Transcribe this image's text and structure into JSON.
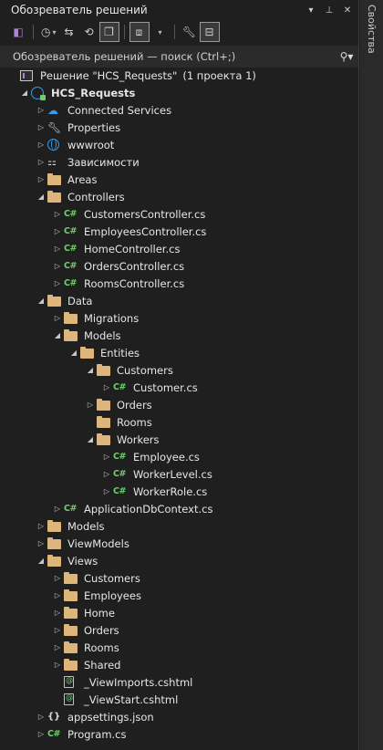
{
  "window": {
    "title": "Обозреватель решений",
    "side_tab_label": "Свойства"
  },
  "toolbar": {
    "icons": [
      "back-forward-icon",
      "history-icon",
      "sync-icon",
      "collapse-all-icon",
      "filter-icon",
      "properties-icon",
      "preview-icon"
    ]
  },
  "search": {
    "placeholder": "Обозреватель решений — поиск (Ctrl+;)"
  },
  "solution": {
    "label": "Решение \"HCS_Requests\"",
    "count": "(1 проекта 1)"
  },
  "tree": [
    {
      "label": "HCS_Requests",
      "level": 0,
      "arrow": "open",
      "icon": "project",
      "bold": true
    },
    {
      "label": "Connected Services",
      "level": 1,
      "arrow": "closed",
      "icon": "cloud"
    },
    {
      "label": "Properties",
      "level": 1,
      "arrow": "closed",
      "icon": "wrench"
    },
    {
      "label": "wwwroot",
      "level": 1,
      "arrow": "closed",
      "icon": "globe"
    },
    {
      "label": "Зависимости",
      "level": 1,
      "arrow": "closed",
      "icon": "deps"
    },
    {
      "label": "Areas",
      "level": 1,
      "arrow": "closed",
      "icon": "folder"
    },
    {
      "label": "Controllers",
      "level": 1,
      "arrow": "open",
      "icon": "folder"
    },
    {
      "label": "CustomersController.cs",
      "level": 2,
      "arrow": "closed",
      "icon": "cs"
    },
    {
      "label": "EmployeesController.cs",
      "level": 2,
      "arrow": "closed",
      "icon": "cs"
    },
    {
      "label": "HomeController.cs",
      "level": 2,
      "arrow": "closed",
      "icon": "cs"
    },
    {
      "label": "OrdersController.cs",
      "level": 2,
      "arrow": "closed",
      "icon": "cs"
    },
    {
      "label": "RoomsController.cs",
      "level": 2,
      "arrow": "closed",
      "icon": "cs"
    },
    {
      "label": "Data",
      "level": 1,
      "arrow": "open",
      "icon": "folder"
    },
    {
      "label": "Migrations",
      "level": 2,
      "arrow": "closed",
      "icon": "folder"
    },
    {
      "label": "Models",
      "level": 2,
      "arrow": "open",
      "icon": "folder"
    },
    {
      "label": "Entities",
      "level": 3,
      "arrow": "open",
      "icon": "folder"
    },
    {
      "label": "Customers",
      "level": 4,
      "arrow": "open",
      "icon": "folder"
    },
    {
      "label": "Customer.cs",
      "level": 5,
      "arrow": "closed",
      "icon": "cs"
    },
    {
      "label": "Orders",
      "level": 4,
      "arrow": "closed",
      "icon": "folder"
    },
    {
      "label": "Rooms",
      "level": 4,
      "arrow": "none",
      "icon": "folder"
    },
    {
      "label": "Workers",
      "level": 4,
      "arrow": "open",
      "icon": "folder"
    },
    {
      "label": "Employee.cs",
      "level": 5,
      "arrow": "closed",
      "icon": "cs"
    },
    {
      "label": "WorkerLevel.cs",
      "level": 5,
      "arrow": "closed",
      "icon": "cs"
    },
    {
      "label": "WorkerRole.cs",
      "level": 5,
      "arrow": "closed",
      "icon": "cs"
    },
    {
      "label": "ApplicationDbContext.cs",
      "level": 2,
      "arrow": "closed",
      "icon": "cs"
    },
    {
      "label": "Models",
      "level": 1,
      "arrow": "closed",
      "icon": "folder"
    },
    {
      "label": "ViewModels",
      "level": 1,
      "arrow": "closed",
      "icon": "folder"
    },
    {
      "label": "Views",
      "level": 1,
      "arrow": "open",
      "icon": "folder"
    },
    {
      "label": "Customers",
      "level": 2,
      "arrow": "closed",
      "icon": "folder"
    },
    {
      "label": "Employees",
      "level": 2,
      "arrow": "closed",
      "icon": "folder"
    },
    {
      "label": "Home",
      "level": 2,
      "arrow": "closed",
      "icon": "folder"
    },
    {
      "label": "Orders",
      "level": 2,
      "arrow": "closed",
      "icon": "folder"
    },
    {
      "label": "Rooms",
      "level": 2,
      "arrow": "closed",
      "icon": "folder"
    },
    {
      "label": "Shared",
      "level": 2,
      "arrow": "closed",
      "icon": "folder"
    },
    {
      "label": "_ViewImports.cshtml",
      "level": 2,
      "arrow": "none",
      "icon": "cshtml"
    },
    {
      "label": "_ViewStart.cshtml",
      "level": 2,
      "arrow": "none",
      "icon": "cshtml"
    },
    {
      "label": "appsettings.json",
      "level": 1,
      "arrow": "closed",
      "icon": "json"
    },
    {
      "label": "Program.cs",
      "level": 1,
      "arrow": "closed",
      "icon": "cs"
    }
  ]
}
